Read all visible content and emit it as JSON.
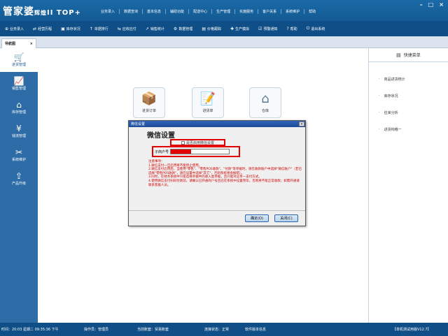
{
  "app": {
    "logo": "管家婆",
    "logo_sub": "辉煌",
    "logo_ver": "II TOP+",
    "window_controls": [
      "–",
      "□",
      "×"
    ]
  },
  "top_menu": [
    "业务录入",
    "数据查询",
    "基本信息",
    "辅助功能",
    "配送中心",
    "生产管理",
    "实施服务",
    "客户关系",
    "系统维护",
    "帮助"
  ],
  "toolbar": [
    {
      "icon": "monitor-icon",
      "glyph": "⊕",
      "label": "业务录入"
    },
    {
      "icon": "flow-icon",
      "glyph": "⇄",
      "label": "经营历程"
    },
    {
      "icon": "stock-icon",
      "glyph": "▣",
      "label": "库存状况"
    },
    {
      "icon": "rank-icon",
      "glyph": "↑",
      "label": "单据排行"
    },
    {
      "icon": "receipt-icon",
      "glyph": "⇆",
      "label": "应收应付"
    },
    {
      "icon": "sales-icon",
      "glyph": "↗",
      "label": "销售统计"
    },
    {
      "icon": "data-icon",
      "glyph": "⚙",
      "label": "数据管理"
    },
    {
      "icon": "price-icon",
      "glyph": "▤",
      "label": "价格跟踪"
    },
    {
      "icon": "production-icon",
      "glyph": "✚",
      "label": "生产模拟"
    },
    {
      "icon": "notify-icon",
      "glyph": "☑",
      "label": "预警通知"
    },
    {
      "icon": "help-icon",
      "glyph": "?",
      "label": "帮助"
    },
    {
      "icon": "exit-icon",
      "glyph": "⏻",
      "label": "退出系统"
    }
  ],
  "tab": {
    "label": "导航图",
    "close": "×"
  },
  "sidebar": [
    {
      "glyph": "🛒",
      "label": "进货管理",
      "active": true
    },
    {
      "glyph": "📈",
      "label": "销售管理",
      "active": false
    },
    {
      "glyph": "⌂",
      "label": "库存管理",
      "active": false
    },
    {
      "glyph": "¥",
      "label": "钱流管理",
      "active": false
    },
    {
      "glyph": "✂",
      "label": "系统维护",
      "active": false
    },
    {
      "glyph": "⇪",
      "label": "产品升级",
      "active": false
    }
  ],
  "nav_cards": [
    {
      "glyph": "📦",
      "label": "进货订单"
    },
    {
      "glyph": "📝",
      "label": "进货单"
    },
    {
      "glyph": "⌂",
      "label": "仓库"
    }
  ],
  "right_panel": {
    "title": "快捷菜单",
    "items": [
      "商品进货统计",
      "库存状况",
      "往来分析",
      "进货钩稽一"
    ]
  },
  "dialog": {
    "title": "微信设置",
    "close": "×",
    "heading": "微信设置",
    "checkbox_label": "是否启用微信设置",
    "account_label": "子商户号",
    "notes": "注意事项：\n1.微信支付一旦启用将不能停止使用。\n2.微信支付启用后，当使用\"零售\"、\"零售POS收款\"、\"付款\"等单据时，请在收款账户中选择\"微信账户\"（若已选择\"零售POS收款\"，请在设置中选择\"其它\"，否则系统将会报错）。\n3.同时，在财务系统中只能选择单据中的收入类单据，且只能对应单一支付方式。\n4.使用微信支付扫码付款前，请确认已开通商户号且已在系统中设置完毕，否则将不能正常收款；如需开通请联系客服人员。",
    "confirm_label": "确定(O)",
    "close_label": "关闭(C)"
  },
  "statusbar": {
    "time": "时间：20:03 星期二 09:35:36 下午",
    "operator": "操作员：管理员",
    "account": "当前账套：贸易账套",
    "connection": "连接状态：正常",
    "version_notice": "软件版本信息",
    "trial": "【单机测试用版V12.7】"
  }
}
